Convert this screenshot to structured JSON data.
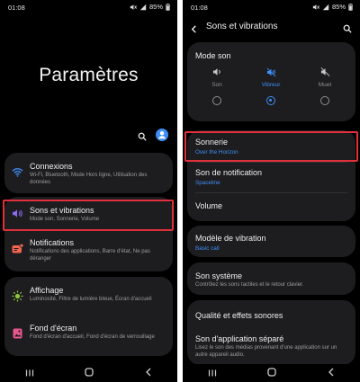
{
  "status": {
    "time": "01:08",
    "battery": "85%"
  },
  "left": {
    "big_title": "Paramètres",
    "items": [
      {
        "title": "Connexions",
        "subtitle": "Wi-Fi, Bluetooth, Mode Hors ligne, Utilisation des données",
        "icon": "wifi-icon",
        "color": "#3f8ef5"
      },
      {
        "title": "Sons et vibrations",
        "subtitle": "Mode son, Sonnerie, Volume",
        "icon": "speaker-icon",
        "color": "#8c6cf0"
      },
      {
        "title": "Notifications",
        "subtitle": "Notifications des applications, Barre d'état, Ne pas déranger",
        "icon": "notification-icon",
        "color": "#f06552"
      },
      {
        "title": "Affichage",
        "subtitle": "Luminosité, Filtre de lumière bleue, Écran d'accueil",
        "icon": "brightness-icon",
        "color": "#8ec63f"
      },
      {
        "title": "Fond d'écran",
        "subtitle": "Fond d'écran d'accueil, Fond d'écran de verrouillage",
        "icon": "wallpaper-icon",
        "color": "#e8568f"
      }
    ]
  },
  "right": {
    "header_title": "Sons et vibrations",
    "mode_title": "Mode son",
    "modes": [
      {
        "label": "Son",
        "icon": "speaker-icon",
        "selected": false
      },
      {
        "label": "Vibreur",
        "icon": "vibrate-icon",
        "selected": true
      },
      {
        "label": "Muet",
        "icon": "mute-icon",
        "selected": false
      }
    ],
    "sonnerie": {
      "title": "Sonnerie",
      "value": "Over the Horizon"
    },
    "notif_sound": {
      "title": "Son de notification",
      "value": "Spaceline"
    },
    "volume": {
      "title": "Volume"
    },
    "vibration": {
      "title": "Modèle de vibration",
      "value": "Basic call"
    },
    "system_sound": {
      "title": "Son système",
      "subtitle": "Contrôlez les sons tactiles et le retour clavier."
    },
    "quality": {
      "title": "Qualité et effets sonores"
    },
    "separate": {
      "title": "Son d'application séparé",
      "subtitle": "Lisez le son des médias provenant d'une application sur un autre appareil audio."
    }
  },
  "colors": {
    "accent": "#3f8ef5",
    "highlight": "#e0303b",
    "card": "#1d1d1f"
  }
}
